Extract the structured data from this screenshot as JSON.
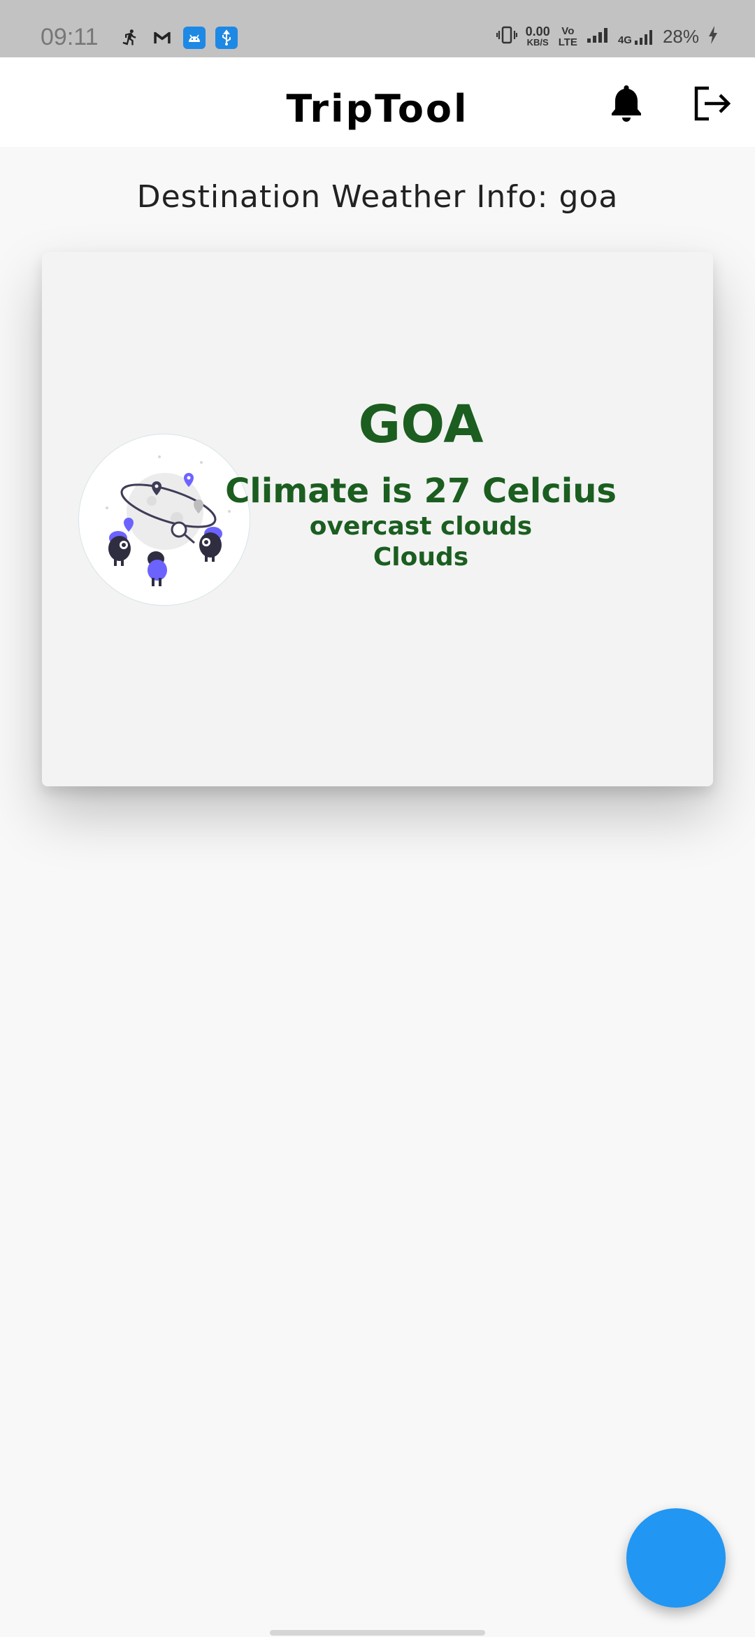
{
  "status_bar": {
    "time": "09:11",
    "data_speed": "0.00",
    "data_unit": "KB/S",
    "volte_top": "Vo",
    "volte_bottom": "LTE",
    "network": "4G",
    "battery": "28%"
  },
  "app_bar": {
    "title": "TripTool"
  },
  "page": {
    "heading": "Destination Weather Info: goa"
  },
  "weather": {
    "city": "GOA",
    "climate": "Climate is 27 Celcius",
    "description": "overcast clouds",
    "main": "Clouds"
  },
  "colors": {
    "accent_green": "#1b5e20",
    "fab_blue": "#2196f3",
    "illustration_purple": "#6c63ff"
  }
}
